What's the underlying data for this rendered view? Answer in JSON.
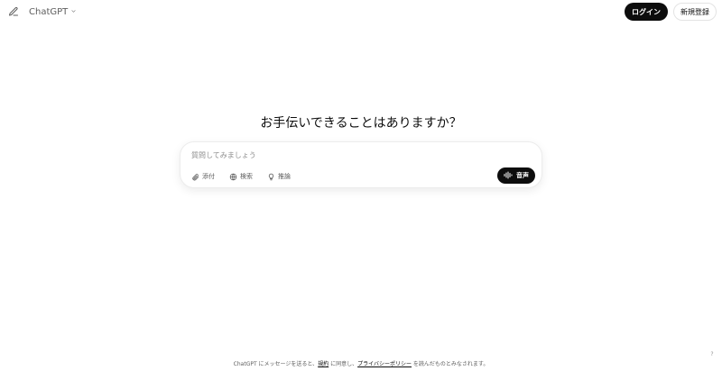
{
  "header": {
    "model_label": "ChatGPT",
    "login_label": "ログイン",
    "signup_label": "新規登録"
  },
  "main": {
    "title": "お手伝いできることはありますか？",
    "composer": {
      "placeholder": "質問してみましょう",
      "tools": [
        {
          "label": "添付",
          "icon": "paperclip-icon"
        },
        {
          "label": "検索",
          "icon": "globe-icon"
        },
        {
          "label": "推論",
          "icon": "lightbulb-icon"
        }
      ],
      "voice_label": "音声"
    }
  },
  "footer": {
    "prefix": "ChatGPT にメッセージを送ると、",
    "terms_link": "規約",
    "middle": " に同意し、",
    "privacy_link": "プライバシーポリシー",
    "suffix": " を読んだものとみなされます。",
    "help": "?"
  }
}
